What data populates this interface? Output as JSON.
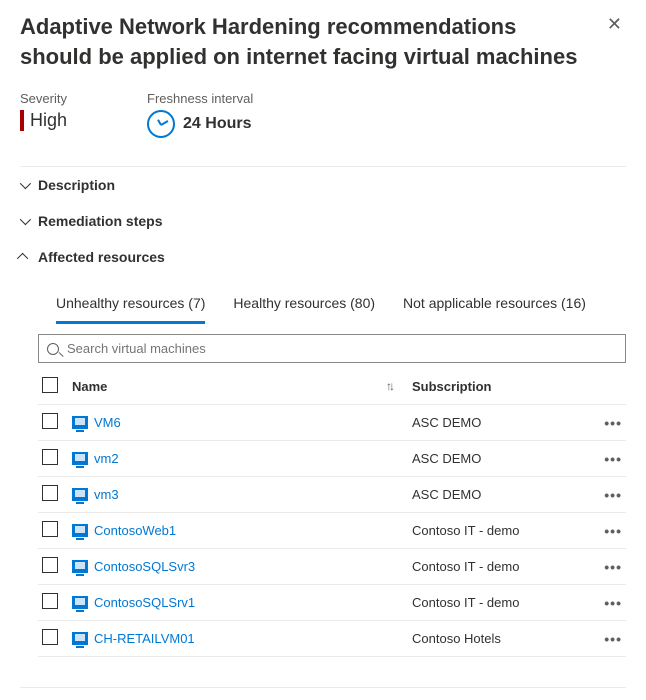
{
  "title": "Adaptive Network Hardening recommendations should be applied on internet facing virtual machines",
  "meta": {
    "severity_label": "Severity",
    "severity_value": "High",
    "freshness_label": "Freshness interval",
    "freshness_value": "24 Hours"
  },
  "sections": {
    "description": "Description",
    "remediation": "Remediation steps",
    "affected": "Affected resources"
  },
  "tabs": {
    "unhealthy": "Unhealthy resources (7)",
    "healthy": "Healthy resources (80)",
    "na": "Not applicable resources (16)"
  },
  "search": {
    "placeholder": "Search virtual machines"
  },
  "columns": {
    "name": "Name",
    "subscription": "Subscription"
  },
  "rows": [
    {
      "name": "VM6",
      "subscription": "ASC DEMO"
    },
    {
      "name": "vm2",
      "subscription": "ASC DEMO"
    },
    {
      "name": "vm3",
      "subscription": "ASC DEMO"
    },
    {
      "name": "ContosoWeb1",
      "subscription": "Contoso IT - demo"
    },
    {
      "name": "ContosoSQLSvr3",
      "subscription": "Contoso IT - demo"
    },
    {
      "name": "ContosoSQLSrv1",
      "subscription": "Contoso IT - demo"
    },
    {
      "name": "CH-RETAILVM01",
      "subscription": "Contoso Hotels"
    }
  ]
}
